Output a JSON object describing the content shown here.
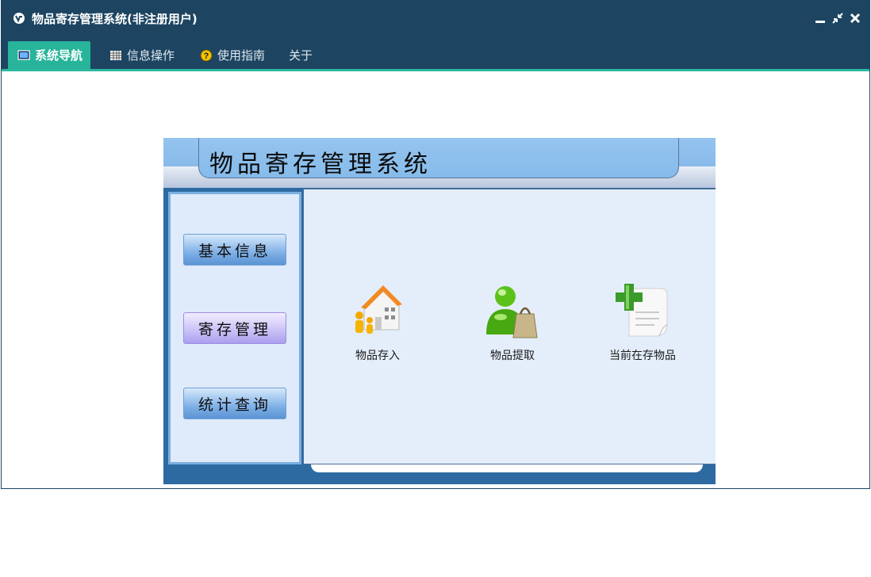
{
  "window": {
    "title": "物品寄存管理系统(非注册用户)",
    "controls": [
      "minimize-icon",
      "restore-icon",
      "close-icon"
    ]
  },
  "menu": {
    "items": [
      {
        "label": "系统导航",
        "icon": "monitor-icon",
        "active": true
      },
      {
        "label": "信息操作",
        "icon": "grid-icon",
        "active": false
      },
      {
        "label": "使用指南",
        "icon": "help-icon",
        "active": false
      },
      {
        "label": "关于",
        "icon": "",
        "active": false
      }
    ]
  },
  "panel": {
    "title": "物品寄存管理系统",
    "sidebar": [
      {
        "label": "基本信息",
        "selected": false
      },
      {
        "label": "寄存管理",
        "selected": true
      },
      {
        "label": "统计查询",
        "selected": false
      }
    ],
    "features": [
      {
        "label": "物品存入",
        "icon": "house-family-icon"
      },
      {
        "label": "物品提取",
        "icon": "user-bag-icon"
      },
      {
        "label": "当前在存物品",
        "icon": "document-add-icon"
      }
    ]
  },
  "colors": {
    "titlebar": "#1d4562",
    "active_tab": "#27b49a",
    "panel_border": "#2d6aa2",
    "main_area": "#e4eefb"
  }
}
